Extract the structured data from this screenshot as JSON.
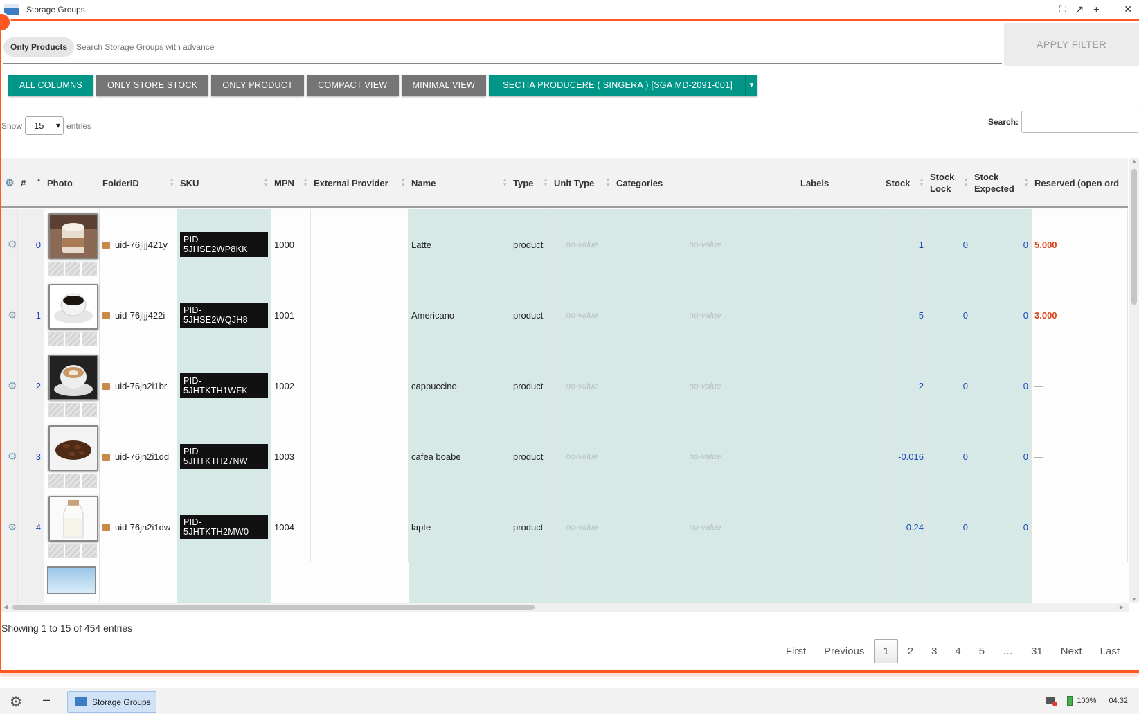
{
  "window": {
    "title": "Storage Groups"
  },
  "filter": {
    "chip": "Only Products",
    "placeholder": "Search Storage Groups with advanced",
    "apply": "APPLY FILTER"
  },
  "views": {
    "all_columns": "ALL COLUMNS",
    "only_store_stock": "ONLY STORE STOCK",
    "only_product": "ONLY PRODUCT",
    "compact": "COMPACT VIEW",
    "minimal": "MINIMAL VIEW",
    "group": "SECTIA PRODUCERE ( SINGERA ) [SGA MD-2091-001]"
  },
  "table_controls": {
    "show": "Show",
    "entries_value": "15",
    "entries": "entries",
    "search": "Search:"
  },
  "columns": [
    "#",
    "Photo",
    "FolderID",
    "SKU",
    "MPN",
    "External Provider",
    "Name",
    "Type",
    "Unit Type",
    "Categories",
    "Labels",
    "Stock",
    "Stock Lock",
    "Stock Expected",
    "Reserved (open ord"
  ],
  "rows": [
    {
      "idx": "0",
      "folder": "uid-76jljj421y",
      "sku": "PID-5JHSE2WP8KK",
      "mpn": "1000",
      "name": "Latte",
      "type": "product",
      "unit": "no-value",
      "categories": "no-value",
      "stock": "1",
      "lock": "0",
      "expected": "0",
      "reserved": "5.000",
      "photo": "latte"
    },
    {
      "idx": "1",
      "folder": "uid-76jljj422i",
      "sku": "PID-5JHSE2WQJH8",
      "mpn": "1001",
      "name": "Americano",
      "type": "product",
      "unit": "no-value",
      "categories": "no-value",
      "stock": "5",
      "lock": "0",
      "expected": "0",
      "reserved": "3.000",
      "photo": "americano"
    },
    {
      "idx": "2",
      "folder": "uid-76jn2i1br",
      "sku": "PID-5JHTKTH1WFK",
      "mpn": "1002",
      "name": "cappuccino",
      "type": "product",
      "unit": "no-value",
      "categories": "no-value",
      "stock": "2",
      "lock": "0",
      "expected": "0",
      "reserved": "—",
      "photo": "cappuccino"
    },
    {
      "idx": "3",
      "folder": "uid-76jn2i1dd",
      "sku": "PID-5JHTKTH27NW",
      "mpn": "1003",
      "name": "cafea boabe",
      "type": "product",
      "unit": "no-value",
      "categories": "no-value",
      "stock": "-0.016",
      "lock": "0",
      "expected": "0",
      "reserved": "—",
      "photo": "beans"
    },
    {
      "idx": "4",
      "folder": "uid-76jn2i1dw",
      "sku": "PID-5JHTKTH2MW0",
      "mpn": "1004",
      "name": "lapte",
      "type": "product",
      "unit": "no-value",
      "categories": "no-value",
      "stock": "-0.24",
      "lock": "0",
      "expected": "0",
      "reserved": "—",
      "photo": "milk"
    }
  ],
  "footer": {
    "info": "Showing 1 to 15 of 454 entries",
    "pages": [
      "First",
      "Previous",
      "1",
      "2",
      "3",
      "4",
      "5",
      "…",
      "31",
      "Next",
      "Last"
    ],
    "active_page": "1"
  },
  "taskbar": {
    "task": "Storage Groups",
    "battery": "100%",
    "clock": "04:32"
  },
  "colors": {
    "accent": "#ff5722",
    "teal": "#009688",
    "gray_button": "#757575",
    "reserved_text": "#d84315",
    "link_number": "#1e48b5"
  }
}
